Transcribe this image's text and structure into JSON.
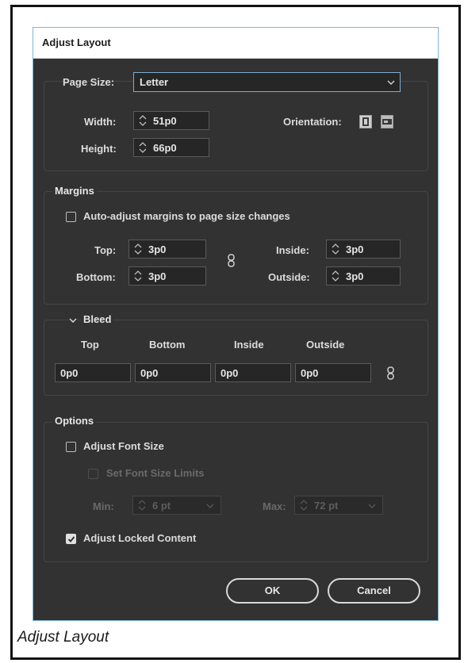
{
  "dialog": {
    "title": "Adjust Layout"
  },
  "page": {
    "page_size_label": "Page Size:",
    "page_size_value": "Letter",
    "width_label": "Width:",
    "width_value": "51p0",
    "height_label": "Height:",
    "height_value": "66p0",
    "orientation_label": "Orientation:"
  },
  "margins": {
    "title": "Margins",
    "auto_adjust_label": "Auto-adjust margins to page size changes",
    "auto_adjust_checked": false,
    "top_label": "Top:",
    "top_value": "3p0",
    "bottom_label": "Bottom:",
    "bottom_value": "3p0",
    "inside_label": "Inside:",
    "inside_value": "3p0",
    "outside_label": "Outside:",
    "outside_value": "3p0"
  },
  "bleed": {
    "title": "Bleed",
    "top_label": "Top",
    "bottom_label": "Bottom",
    "inside_label": "Inside",
    "outside_label": "Outside",
    "top_value": "0p0",
    "bottom_value": "0p0",
    "inside_value": "0p0",
    "outside_value": "0p0"
  },
  "options": {
    "title": "Options",
    "adjust_font_label": "Adjust Font Size",
    "adjust_font_checked": false,
    "set_limits_label": "Set Font Size Limits",
    "set_limits_checked": false,
    "min_label": "Min:",
    "min_value": "6 pt",
    "max_label": "Max:",
    "max_value": "72 pt",
    "adjust_locked_label": "Adjust Locked Content",
    "adjust_locked_checked": true
  },
  "buttons": {
    "ok_label": "OK",
    "cancel_label": "Cancel"
  },
  "caption": "Adjust Layout",
  "colors": {
    "dialog_bg": "#323232",
    "accent": "#7eaed0"
  },
  "icons": [
    "chevron-down-icon",
    "stepper-icon",
    "portrait-icon",
    "landscape-icon",
    "chain-link-icon",
    "checkmark-icon"
  ]
}
